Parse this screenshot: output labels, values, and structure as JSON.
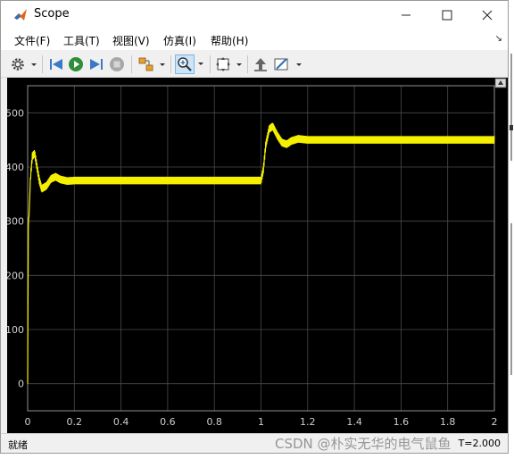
{
  "window": {
    "title": "Scope"
  },
  "menu": [
    {
      "label": "文件(F)"
    },
    {
      "label": "工具(T)"
    },
    {
      "label": "视图(V)"
    },
    {
      "label": "仿真(I)"
    },
    {
      "label": "帮助(H)"
    }
  ],
  "toolbar": {
    "icons": [
      "gear-icon",
      "step-back-icon",
      "run-icon",
      "step-forward-icon",
      "stop-icon",
      "highlight-block-icon",
      "zoom-in-icon",
      "zoom-fit-icon",
      "restore-icon",
      "properties-icon"
    ]
  },
  "status": {
    "left": "就绪",
    "right": "T=2.000"
  },
  "watermark": "CSDN @朴实无华的电气鼠鱼",
  "colors": {
    "plot_bg": "#000000",
    "grid": "#4a4a4a",
    "signal": "#f4f000",
    "axis_text": "#d0d0d0"
  },
  "chart_data": {
    "type": "line",
    "title": "",
    "xlabel": "",
    "ylabel": "",
    "xlim": [
      0,
      2
    ],
    "ylim": [
      -50,
      550
    ],
    "xticks": [
      "0",
      "0.2",
      "0.4",
      "0.6",
      "0.8",
      "1",
      "1.2",
      "1.4",
      "1.6",
      "1.8",
      "2"
    ],
    "yticks": [
      "0",
      "100",
      "200",
      "300",
      "400",
      "500"
    ],
    "grid": true,
    "series": [
      {
        "x": [
          0,
          0.003,
          0.006,
          0.012,
          0.02,
          0.03,
          0.04,
          0.05,
          0.06,
          0.08,
          0.1,
          0.12,
          0.14,
          0.17,
          0.2,
          0.3,
          0.5,
          0.7,
          0.9,
          1.0,
          1.01,
          1.02,
          1.035,
          1.05,
          1.07,
          1.09,
          1.11,
          1.13,
          1.16,
          1.2,
          1.4,
          1.6,
          1.8,
          2.0
        ],
        "y": [
          0,
          300,
          310,
          380,
          420,
          425,
          400,
          375,
          360,
          365,
          378,
          382,
          377,
          374,
          375,
          375,
          375,
          375,
          375,
          375,
          395,
          440,
          470,
          475,
          458,
          445,
          442,
          448,
          452,
          450,
          450,
          450,
          450,
          450
        ],
        "ripple": 7
      }
    ]
  }
}
